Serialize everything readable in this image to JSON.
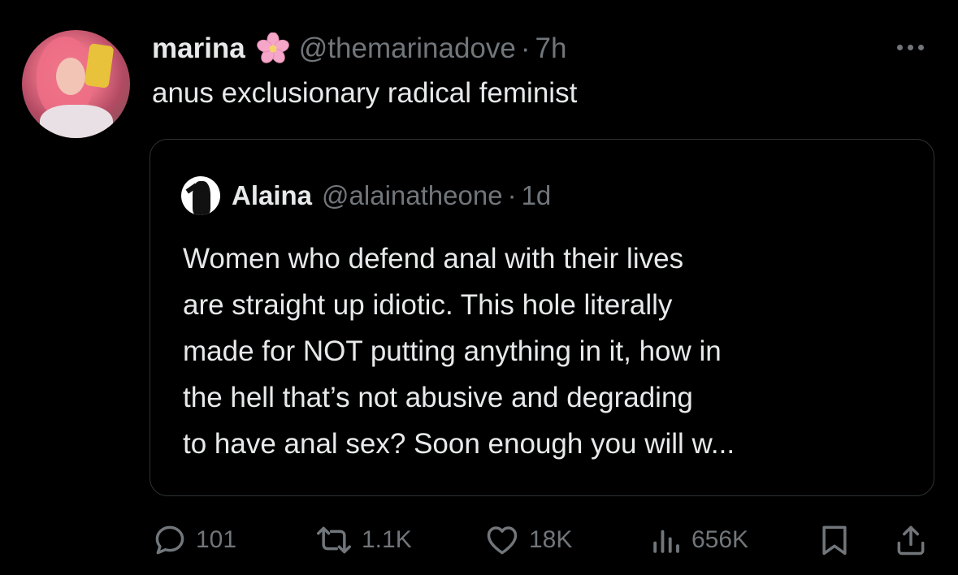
{
  "author": {
    "name": "marina",
    "emoji": "flower-emoji",
    "handle": "@themarinadove",
    "separator": "·",
    "time": "7h"
  },
  "tweet": {
    "text": "anus exclusionary radical feminist"
  },
  "quoted": {
    "name": "Alaina",
    "handle": "@alainatheone",
    "separator": "·",
    "time": "1d",
    "lines": [
      "Women who defend anal with their lives",
      "are straight up idiotic. This hole literally",
      "made for NOT putting anything in it, how in",
      "the hell that’s not abusive and degrading",
      "to have anal sex? Soon enough you will w..."
    ]
  },
  "actions": {
    "replies": "101",
    "reposts": "1.1K",
    "likes": "18K",
    "views": "656K"
  },
  "colors": {
    "background": "#000000",
    "text": "#e7e9ea",
    "muted": "#71767b",
    "border": "#2f3336",
    "flower": "#f6a6c8"
  }
}
